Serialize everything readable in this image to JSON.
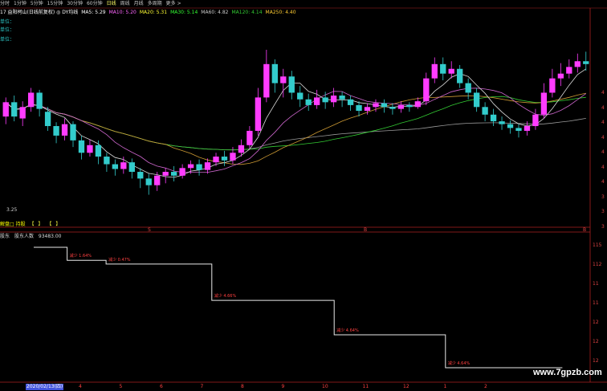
{
  "tabs": [
    "分时",
    "1分钟",
    "5分钟",
    "15分钟",
    "30分钟",
    "60分钟",
    "日线",
    "周线",
    "月线",
    "多周期",
    "更多 >"
  ],
  "active_tab": 6,
  "ma_line": {
    "stock": "17 益阳柯山(日线前复权) ◎ DY均线",
    "items": [
      {
        "label": "MA5: 5.29",
        "color": "#ffffff"
      },
      {
        "label": "MA10: 5.20",
        "color": "#ff66ff"
      },
      {
        "label": "MA20: 5.31",
        "color": "#ffff33"
      },
      {
        "label": "MA30: 5.14",
        "color": "#33ff33"
      },
      {
        "label": "MA60: 4.82",
        "color": "#cccccc"
      },
      {
        "label": "MA120: 4.14",
        "color": "#33cc33"
      },
      {
        "label": "MA250: 4.40",
        "color": "#ffcc33"
      }
    ]
  },
  "side_tags": [
    "单位：",
    "单位：",
    "单位："
  ],
  "y_axis_right": [
    "4",
    "4",
    "4",
    "4",
    "4",
    "4",
    "4",
    "3",
    "3",
    "3"
  ],
  "low_price_label": "3.25",
  "indicator_header": {
    "text": "解盘□ 持股",
    "boxes": [
      "【",
      "】",
      "【",
      "】"
    ]
  },
  "pane2": {
    "title": "股东",
    "field": "股东人数",
    "value": "93483.00",
    "y_labels": [
      "115",
      "112",
      "11",
      "11",
      "12",
      "12",
      "12"
    ]
  },
  "step_annotations": [
    "减少 1.64%",
    "减少 0.47%",
    "减少 4.66%",
    "减少 4.64%",
    "减少 4.64%"
  ],
  "x_labels": [
    "2020/02/13(四)",
    "4",
    "5",
    "6",
    "7",
    "8",
    "9",
    "10",
    "11",
    "12",
    "1",
    "2"
  ],
  "pane_dividers_labels": [
    "S",
    "B",
    "B"
  ],
  "watermark": "www.7gpzb.com",
  "colors": {
    "up": "#ff3cff",
    "down": "#33cccc",
    "ma5": "#ffffff",
    "ma10": "#ff66ff",
    "ma20": "#ffff33",
    "ma30": "#33ff33",
    "ma60": "#cccccc"
  },
  "chart_data": {
    "type": "candlestick",
    "price_range": [
      3.25,
      4.9
    ],
    "candles": [
      [
        4.2,
        4.35,
        4.12,
        4.4
      ],
      [
        4.35,
        4.2,
        4.15,
        4.42
      ],
      [
        4.18,
        4.3,
        4.1,
        4.36
      ],
      [
        4.3,
        4.45,
        4.25,
        4.5
      ],
      [
        4.45,
        4.28,
        4.2,
        4.48
      ],
      [
        4.25,
        4.1,
        4.05,
        4.3
      ],
      [
        4.1,
        4.0,
        3.92,
        4.14
      ],
      [
        4.0,
        4.12,
        3.95,
        4.18
      ],
      [
        4.12,
        3.95,
        3.88,
        4.15
      ],
      [
        3.95,
        3.82,
        3.75,
        4.0
      ],
      [
        3.82,
        3.9,
        3.78,
        3.96
      ],
      [
        3.9,
        3.78,
        3.7,
        3.95
      ],
      [
        3.78,
        3.7,
        3.62,
        3.82
      ],
      [
        3.7,
        3.65,
        3.58,
        3.75
      ],
      [
        3.65,
        3.72,
        3.6,
        3.78
      ],
      [
        3.72,
        3.62,
        3.55,
        3.76
      ],
      [
        3.62,
        3.55,
        3.45,
        3.66
      ],
      [
        3.55,
        3.48,
        3.38,
        3.6
      ],
      [
        3.48,
        3.58,
        3.42,
        3.62
      ],
      [
        3.58,
        3.62,
        3.5,
        3.66
      ],
      [
        3.62,
        3.58,
        3.52,
        3.68
      ],
      [
        3.58,
        3.66,
        3.55,
        3.7
      ],
      [
        3.66,
        3.7,
        3.6,
        3.74
      ],
      [
        3.7,
        3.64,
        3.58,
        3.75
      ],
      [
        3.64,
        3.72,
        3.6,
        3.76
      ],
      [
        3.72,
        3.78,
        3.68,
        3.82
      ],
      [
        3.78,
        3.74,
        3.68,
        3.84
      ],
      [
        3.74,
        3.82,
        3.7,
        3.88
      ],
      [
        3.82,
        3.9,
        3.78,
        3.96
      ],
      [
        3.9,
        4.05,
        3.86,
        4.1
      ],
      [
        4.05,
        4.4,
        4.0,
        4.5
      ],
      [
        4.4,
        4.75,
        4.35,
        4.9
      ],
      [
        4.75,
        4.55,
        4.45,
        4.8
      ],
      [
        4.55,
        4.62,
        4.4,
        4.7
      ],
      [
        4.62,
        4.45,
        4.38,
        4.68
      ],
      [
        4.45,
        4.38,
        4.3,
        4.52
      ],
      [
        4.38,
        4.32,
        4.26,
        4.44
      ],
      [
        4.32,
        4.4,
        4.28,
        4.48
      ],
      [
        4.4,
        4.35,
        4.28,
        4.46
      ],
      [
        4.35,
        4.42,
        4.3,
        4.5
      ],
      [
        4.42,
        4.38,
        4.3,
        4.46
      ],
      [
        4.38,
        4.32,
        4.26,
        4.42
      ],
      [
        4.32,
        4.26,
        4.2,
        4.36
      ],
      [
        4.26,
        4.3,
        4.22,
        4.34
      ],
      [
        4.3,
        4.34,
        4.25,
        4.38
      ],
      [
        4.34,
        4.3,
        4.24,
        4.38
      ],
      [
        4.3,
        4.28,
        4.22,
        4.34
      ],
      [
        4.28,
        4.32,
        4.24,
        4.36
      ],
      [
        4.32,
        4.3,
        4.25,
        4.35
      ],
      [
        4.3,
        4.36,
        4.28,
        4.4
      ],
      [
        4.36,
        4.6,
        4.32,
        4.66
      ],
      [
        4.6,
        4.75,
        4.55,
        4.82
      ],
      [
        4.75,
        4.65,
        4.58,
        4.82
      ],
      [
        4.65,
        4.7,
        4.6,
        4.78
      ],
      [
        4.7,
        4.55,
        4.5,
        4.74
      ],
      [
        4.55,
        4.45,
        4.38,
        4.6
      ],
      [
        4.45,
        4.3,
        4.25,
        4.5
      ],
      [
        4.3,
        4.22,
        4.15,
        4.35
      ],
      [
        4.22,
        4.15,
        4.1,
        4.28
      ],
      [
        4.15,
        4.12,
        4.06,
        4.2
      ],
      [
        4.12,
        4.08,
        4.02,
        4.16
      ],
      [
        4.08,
        4.05,
        3.98,
        4.12
      ],
      [
        4.05,
        4.1,
        4.0,
        4.15
      ],
      [
        4.1,
        4.22,
        4.06,
        4.28
      ],
      [
        4.22,
        4.45,
        4.18,
        4.55
      ],
      [
        4.45,
        4.6,
        4.4,
        4.7
      ],
      [
        4.6,
        4.65,
        4.52,
        4.76
      ],
      [
        4.65,
        4.72,
        4.6,
        4.8
      ],
      [
        4.72,
        4.78,
        4.66,
        4.86
      ],
      [
        4.78,
        4.75,
        4.68,
        4.88
      ]
    ],
    "shareholders_steps": [
      93483,
      91950,
      91518,
      87255,
      83207,
      79347
    ],
    "step_annotations": [
      "减少 1.64%",
      "减少 0.47%",
      "减少 4.66%",
      "减少 4.64%",
      "减少 4.64%"
    ]
  }
}
